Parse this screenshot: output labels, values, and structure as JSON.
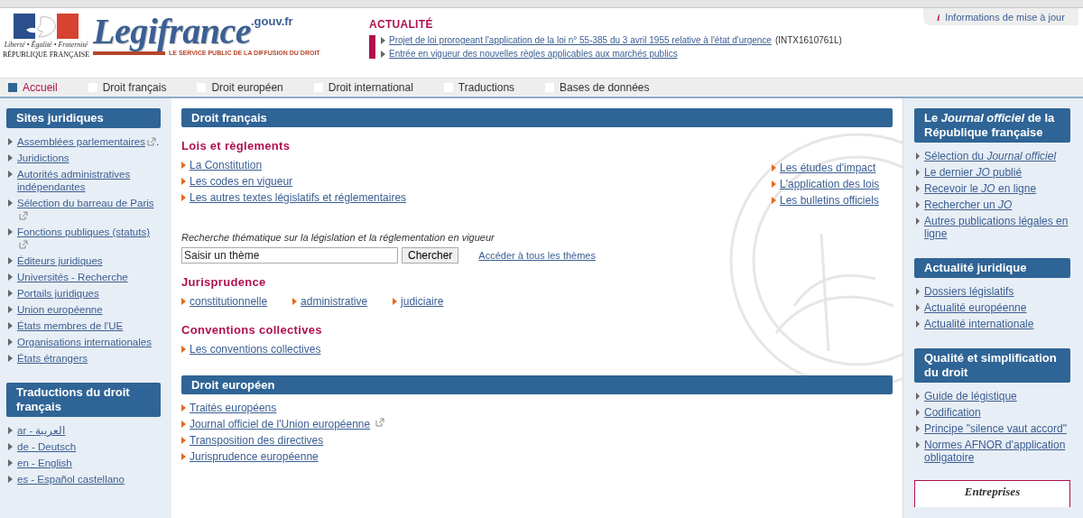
{
  "header": {
    "logo": {
      "motto": "Liberté • Égalité • Fraternité",
      "republic": "RÉPUBLIQUE FRANÇAISE",
      "brand": "Legifrance",
      "domain": ".gouv.fr",
      "tagline": "LE SERVICE PUBLIC DE LA DIFFUSION DU DROIT"
    },
    "news": {
      "title": "ACTUALITÉ",
      "items": [
        {
          "link": "Projet de loi prorogeant l'application de la loi n° 55-385 du 3 avril 1955 relative à l'état d'urgence",
          "suffix": "(INTX1610761L)"
        },
        {
          "link": "Entrée en vigueur des nouvelles règles applicables aux marchés publics"
        }
      ]
    },
    "info": {
      "icon": "i",
      "label": "Informations de mise à jour"
    }
  },
  "tabs": [
    {
      "label": "Accueil",
      "selected": true
    },
    {
      "label": "Droit français",
      "selected": false
    },
    {
      "label": "Droit européen",
      "selected": false
    },
    {
      "label": "Droit international",
      "selected": false
    },
    {
      "label": "Traductions",
      "selected": false
    },
    {
      "label": "Bases de données",
      "selected": false
    }
  ],
  "left_panels": [
    {
      "title": "Sites juridiques",
      "links": [
        {
          "text": "Assemblées parlementaires",
          "external": true,
          "suffix": "."
        },
        {
          "text": "Juridictions",
          "external": false
        },
        {
          "text": "Autorités administratives indépendantes",
          "external": false
        },
        {
          "text": "Sélection du barreau de Paris",
          "external": true
        },
        {
          "text": "Fonctions publiques (statuts)",
          "external": true
        },
        {
          "text": "Éditeurs juridiques",
          "external": false
        },
        {
          "text": "Universités - Recherche",
          "external": false
        },
        {
          "text": "Portails juridiques",
          "external": false
        },
        {
          "text": "Union européenne",
          "external": false
        },
        {
          "text": "États membres de l'UE",
          "external": false
        },
        {
          "text": "Organisations internationales",
          "external": false
        },
        {
          "text": "États étrangers",
          "external": false
        }
      ]
    },
    {
      "title": "Traductions du droit français",
      "links": [
        {
          "text": "ar - العربية",
          "external": false
        },
        {
          "text": "de - Deutsch",
          "external": false
        },
        {
          "text": "en - English",
          "external": false
        },
        {
          "text": "es - Español castellano",
          "external": false
        }
      ]
    }
  ],
  "center": {
    "panels": [
      {
        "title": "Droit français",
        "sections": [
          {
            "kind": "columns",
            "heading": "Lois et règlements",
            "links": [
              "La Constitution",
              "Les codes en vigueur",
              "Les autres textes législatifs et réglementaires"
            ],
            "side_links": [
              "Les études d'impact",
              "L'application des lois",
              "Les bulletins officiels"
            ]
          },
          {
            "kind": "search",
            "caption": "Recherche thématique sur la législation et la réglementation en vigueur",
            "placeholder": "Saisir un thème",
            "button": "Chercher",
            "link": "Accéder à tous les thèmes"
          },
          {
            "kind": "inline",
            "heading": "Jurisprudence",
            "links": [
              "constitutionnelle",
              "administrative",
              "judiciaire"
            ]
          },
          {
            "kind": "list",
            "heading": "Conventions collectives",
            "links": [
              {
                "text": "Les conventions collectives",
                "external": false
              }
            ]
          }
        ]
      },
      {
        "title": "Droit européen",
        "sections": [
          {
            "kind": "list",
            "links": [
              {
                "text": "Traités européens",
                "external": false
              },
              {
                "text": "Journal officiel de l'Union européenne",
                "external": true
              },
              {
                "text": "Transposition des directives",
                "external": false
              },
              {
                "text": "Jurisprudence européenne",
                "external": false
              }
            ]
          }
        ]
      }
    ]
  },
  "right_panels": [
    {
      "title": "Le *Journal officiel* de la République française",
      "links": [
        "Sélection du *Journal officiel*",
        "Le dernier *JO* publié",
        "Recevoir le *JO* en ligne",
        "Rechercher un *JO*",
        "Autres publications légales en ligne"
      ]
    },
    {
      "title": "Actualité juridique",
      "links": [
        "Dossiers législatifs",
        "Actualité européenne",
        "Actualité internationale"
      ]
    },
    {
      "title": "Qualité et simplification du droit",
      "links": [
        "Guide de légistique",
        "Codification",
        "Principe \"silence vaut accord\"",
        "Normes AFNOR d'application obligatoire"
      ]
    }
  ],
  "promo": {
    "label": "Entreprises"
  }
}
